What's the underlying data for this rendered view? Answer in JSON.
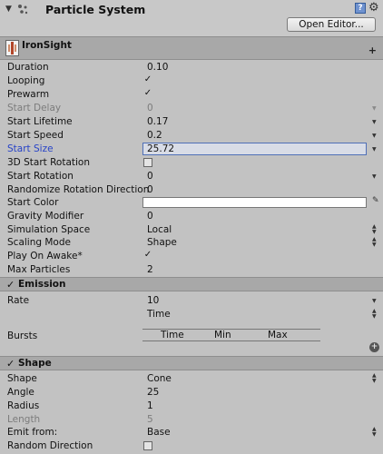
{
  "header": {
    "fold_glyph": "▼",
    "title": "Particle System",
    "help_glyph": "?",
    "gear_glyph": "⚙",
    "open_editor_label": "Open Editor..."
  },
  "main_module": {
    "title": "IronSight"
  },
  "properties": {
    "duration": {
      "label": "Duration",
      "value": "0.10"
    },
    "looping": {
      "label": "Looping",
      "checked": true
    },
    "prewarm": {
      "label": "Prewarm",
      "checked": true
    },
    "start_delay": {
      "label": "Start Delay",
      "value": "0"
    },
    "start_lifetime": {
      "label": "Start Lifetime",
      "value": "0.17"
    },
    "start_speed": {
      "label": "Start Speed",
      "value": "0.2"
    },
    "start_size": {
      "label": "Start Size",
      "value": "25.72"
    },
    "start_rotation_3d": {
      "label": "3D Start Rotation",
      "checked": false
    },
    "start_rotation": {
      "label": "Start Rotation",
      "value": "0"
    },
    "randomize_rotation": {
      "label": "Randomize Rotation Direction",
      "value": "0"
    },
    "start_color": {
      "label": "Start Color",
      "color": "#ffffff"
    },
    "gravity_modifier": {
      "label": "Gravity Modifier",
      "value": "0"
    },
    "simulation_space": {
      "label": "Simulation Space",
      "value": "Local"
    },
    "scaling_mode": {
      "label": "Scaling Mode",
      "value": "Shape"
    },
    "play_on_awake": {
      "label": "Play On Awake*",
      "checked": true
    },
    "max_particles": {
      "label": "Max Particles",
      "value": "2"
    }
  },
  "emission": {
    "title": "Emission",
    "rate_label": "Rate",
    "rate_value": "10",
    "rate_mode": "Time",
    "bursts_label": "Bursts",
    "bursts_columns": [
      "Time",
      "Min",
      "Max"
    ]
  },
  "shape": {
    "title": "Shape",
    "shape": {
      "label": "Shape",
      "value": "Cone"
    },
    "angle": {
      "label": "Angle",
      "value": "25"
    },
    "radius": {
      "label": "Radius",
      "value": "1"
    },
    "length": {
      "label": "Length",
      "value": "5"
    },
    "emit_from": {
      "label": "Emit from:",
      "value": "Base"
    },
    "random_direction": {
      "label": "Random Direction",
      "checked": false
    }
  },
  "glyphs": {
    "check": "✓",
    "dropdown": "▼",
    "updown": "▲▼",
    "color_picker": "✎",
    "add": "+"
  }
}
